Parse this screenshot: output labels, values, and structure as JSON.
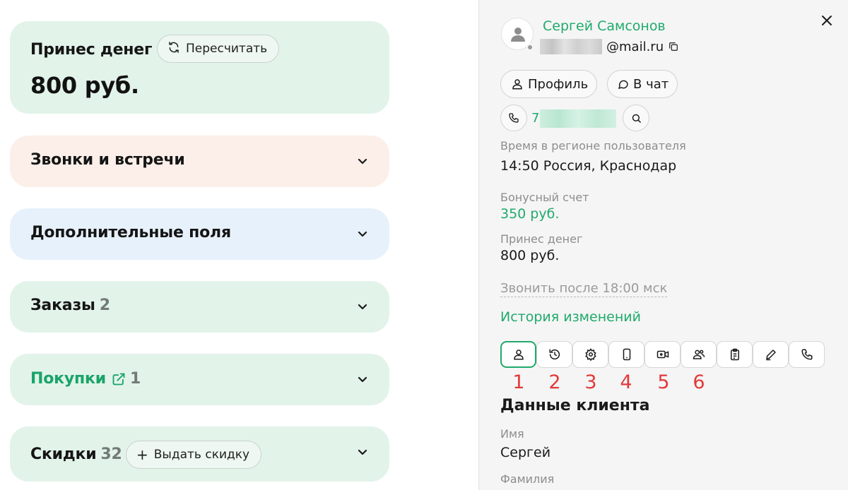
{
  "left": {
    "earned": {
      "title": "Принес денег",
      "recalc_label": "Пересчитать",
      "amount": "800 руб."
    },
    "calls": {
      "title": "Звонки и встречи"
    },
    "extra_fields": {
      "title": "Дополнительные поля"
    },
    "orders": {
      "title": "Заказы",
      "count": "2"
    },
    "purchases": {
      "title": "Покупки",
      "count": "1"
    },
    "discounts": {
      "title": "Скидки",
      "count": "32",
      "give_label": "Выдать скидку"
    }
  },
  "panel": {
    "user_name": "Сергей Самсонов",
    "email_suffix": "@mail.ru",
    "profile_label": "Профиль",
    "chat_label": "В чат",
    "phone_prefix": "7",
    "time_label": "Время в регионе пользователя",
    "time_value": "14:50  Россия, Краснодар",
    "bonus_label": "Бонусный счет",
    "bonus_value": "350 руб.",
    "earned_label": "Принес денег",
    "earned_value": "800 руб.",
    "call_after": "Звонить после 18:00 мск",
    "history_link": "История изменений",
    "tab_numbers": [
      "1",
      "2",
      "3",
      "4",
      "5",
      "6"
    ],
    "section_title": "Данные клиента",
    "first_name_label": "Имя",
    "first_name_value": "Сергей",
    "last_name_label": "Фамилия"
  },
  "colors": {
    "accent": "#1faa6b",
    "card_green": "#e2f3ea",
    "card_peach": "#fcefe9",
    "card_blue": "#e7f1fb",
    "annotation_red": "#e23a3a"
  }
}
